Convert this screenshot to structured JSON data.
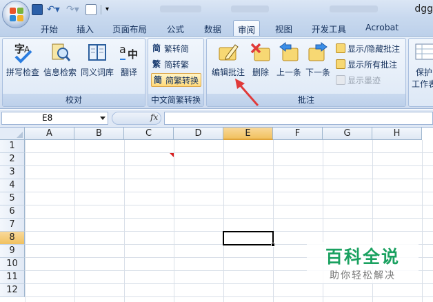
{
  "window": {
    "title": "dgg"
  },
  "quick_access": [
    "save-icon",
    "undo-icon",
    "redo-icon",
    "print-preview-icon"
  ],
  "tabs": [
    {
      "label": "开始"
    },
    {
      "label": "插入"
    },
    {
      "label": "页面布局"
    },
    {
      "label": "公式"
    },
    {
      "label": "数据"
    },
    {
      "label": "审阅"
    },
    {
      "label": "视图"
    },
    {
      "label": "开发工具"
    },
    {
      "label": "Acrobat"
    }
  ],
  "active_tab": "审阅",
  "ribbon": {
    "proofing": {
      "label": "校对",
      "spell_check": "拼写检查",
      "research": "信息检索",
      "thesaurus": "同义词库",
      "translate": "翻译"
    },
    "chinese_conversion": {
      "label": "中文简繁转换",
      "to_simplified": "繁转简",
      "to_traditional": "简转繁",
      "convert": "简繁转换"
    },
    "comments": {
      "label": "批注",
      "edit_comment": "编辑批注",
      "delete": "删除",
      "previous": "上一条",
      "next": "下一条",
      "show_hide": "显示/隐藏批注",
      "show_all": "显示所有批注",
      "show_ink": "显示墨迹"
    },
    "changes": {
      "protect": "保护",
      "protect_line2": "工作表"
    }
  },
  "formula_bar": {
    "name_box": "E8",
    "fx": "fx",
    "value": ""
  },
  "sheet": {
    "columns": [
      "A",
      "B",
      "C",
      "D",
      "E",
      "F",
      "G",
      "H"
    ],
    "rows": [
      "1",
      "2",
      "3",
      "4",
      "5",
      "6",
      "7",
      "8",
      "9",
      "10",
      "11",
      "12"
    ],
    "active_column": "E",
    "active_row": "8"
  },
  "watermark": {
    "title": "百科全说",
    "subtitle": "助你轻松解决"
  },
  "colors": {
    "accent": "#1aa160",
    "arrow": "#e03a3a",
    "ribbon": "#dbe6f5"
  }
}
